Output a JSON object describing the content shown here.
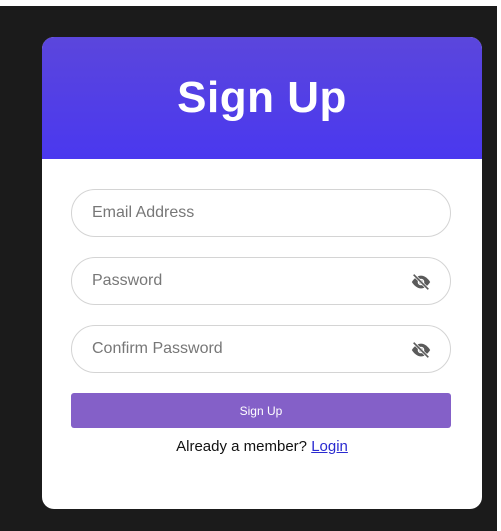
{
  "header": {
    "title": "Sign Up"
  },
  "form": {
    "email": {
      "placeholder": "Email Address",
      "value": ""
    },
    "password": {
      "placeholder": "Password",
      "value": "",
      "toggle_icon": "eye-slash-icon"
    },
    "confirm_password": {
      "placeholder": "Confirm Password",
      "value": "",
      "toggle_icon": "eye-slash-icon"
    },
    "submit_label": "Sign Up"
  },
  "footer": {
    "prompt": "Already a member?",
    "link_label": "Login"
  },
  "colors": {
    "header_gradient_top": "#5b46dc",
    "header_gradient_bottom": "#4a38ef",
    "button": "#8460c8",
    "link": "#2a2ad0",
    "background": "#1b1b1b"
  }
}
